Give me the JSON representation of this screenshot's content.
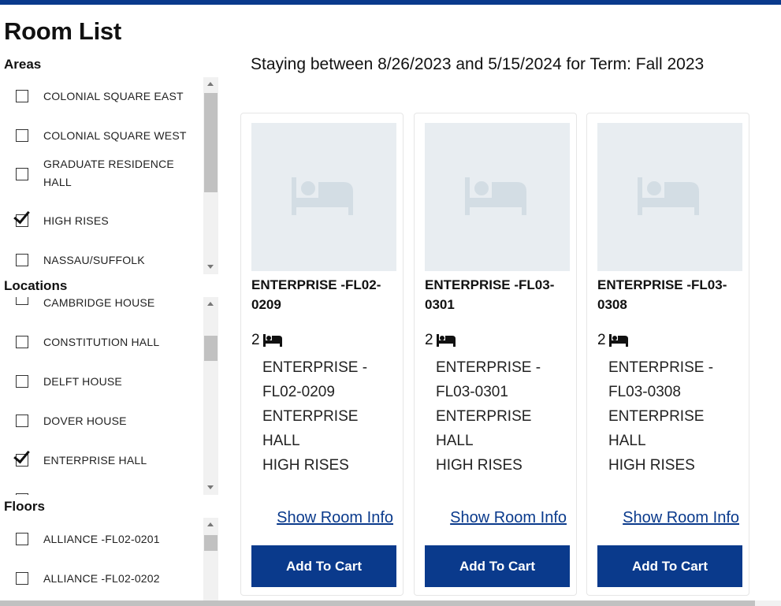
{
  "page": {
    "title": "Room List"
  },
  "filters": {
    "areas": {
      "title": "Areas",
      "items": [
        {
          "label": "COLONIAL SQUARE EAST",
          "checked": false
        },
        {
          "label": "COLONIAL SQUARE WEST",
          "checked": false
        },
        {
          "label": "GRADUATE RESIDENCE HALL",
          "checked": false
        },
        {
          "label": "HIGH RISES",
          "checked": true
        },
        {
          "label": "NASSAU/SUFFOLK",
          "checked": false
        }
      ]
    },
    "locations": {
      "title": "Locations",
      "items": [
        {
          "label": "CAMBRIDGE HOUSE",
          "checked": false
        },
        {
          "label": "CONSTITUTION HALL",
          "checked": false
        },
        {
          "label": "DELFT HOUSE",
          "checked": false
        },
        {
          "label": "DOVER HOUSE",
          "checked": false
        },
        {
          "label": "ENTERPRISE HALL",
          "checked": true
        }
      ]
    },
    "floors": {
      "title": "Floors",
      "items": [
        {
          "label": "ALLIANCE -FL02-0201",
          "checked": false
        },
        {
          "label": "ALLIANCE -FL02-0202",
          "checked": false
        }
      ]
    }
  },
  "stay": {
    "text": "Staying between 8/26/2023 and 5/15/2024 for Term: Fall 2023"
  },
  "rooms": [
    {
      "title": "ENTERPRISE -FL02-0209",
      "beds": "2",
      "name": "ENTERPRISE -FL02-0209",
      "hall": "ENTERPRISE HALL",
      "area": "HIGH RISES",
      "info_link": "Show Room Info",
      "cart_button": "Add To Cart"
    },
    {
      "title": "ENTERPRISE -FL03-0301",
      "beds": "2",
      "name": "ENTERPRISE -FL03-0301",
      "hall": "ENTERPRISE HALL",
      "area": "HIGH RISES",
      "info_link": "Show Room Info",
      "cart_button": "Add To Cart"
    },
    {
      "title": "ENTERPRISE -FL03-0308",
      "beds": "2",
      "name": "ENTERPRISE -FL03-0308",
      "hall": "ENTERPRISE HALL",
      "area": "HIGH RISES",
      "info_link": "Show Room Info",
      "cart_button": "Add To Cart"
    }
  ],
  "icons": {
    "bed": "bed-icon",
    "placeholder": "bed-placeholder-icon"
  },
  "colors": {
    "brand": "#0a3a8c",
    "placeholder_bg": "#e8edf1"
  }
}
